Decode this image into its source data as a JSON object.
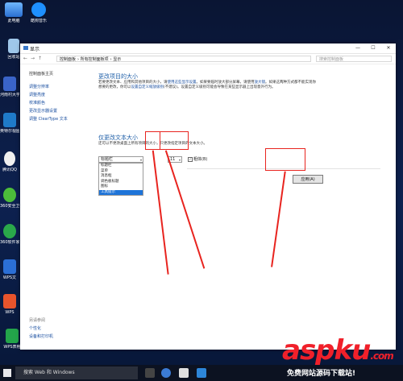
{
  "desktop": {
    "icons": [
      {
        "label": "此电脑"
      },
      {
        "label": "酷狗音乐"
      },
      {
        "label": "回收站"
      },
      {
        "label": "河南村大学认"
      },
      {
        "label": "英特尔视图形"
      },
      {
        "label": "腾讯QQ"
      },
      {
        "label": "360安全卫士"
      },
      {
        "label": "360软件家"
      },
      {
        "label": "WPS文"
      },
      {
        "label": "WPS"
      },
      {
        "label": "WPS表格"
      }
    ]
  },
  "window": {
    "title": "显示",
    "address": {
      "path": [
        "控制面板",
        "所有控制面板项",
        "显示"
      ],
      "search_placeholder": "搜索控制面板"
    },
    "sidebar": {
      "home": "控制面板主页",
      "items": [
        "调整分辨率",
        "调整亮度",
        "校准颜色",
        "更改显示器设置",
        "调整 ClearType 文本"
      ],
      "see_also_title": "另请参阅",
      "see_also": [
        "个性化",
        "设备和打印机"
      ]
    },
    "main": {
      "heading1": "更改项目的大小",
      "para1_a": "若要更改文本、应用和其他项目的大小，请",
      "para1_link1": "使用这些显示设置",
      "para1_b": "。如果要临时放大部分屏幕，请使用",
      "para1_link2": "放大镜",
      "para1_c": "。如果这两种方式都不能实现你想要的更改，你可以",
      "para1_link3": "设置自定义缩放级别",
      "para1_d": "(不建议)。设置自定义级别可能会导致在某些显示器上出现意外行为。",
      "heading2": "仅更改文本大小",
      "para2": "还可以不更改桌面上所有项目的大小，只更改指定项目的文本大小。",
      "item_select": "标题栏",
      "size_select": "11",
      "bold_label": "粗体(B)",
      "dropdown_options": [
        "标题栏",
        "菜单",
        "消息框",
        "调色板标题",
        "图标",
        "工具提示"
      ],
      "selected_option": "工具提示",
      "apply_button": "应用(A)"
    }
  },
  "taskbar": {
    "search_placeholder": "搜索 Web 和 Windows"
  },
  "watermark": {
    "brand": "aspku",
    "suffix": ".com",
    "tagline": "免费网站源码下载站!"
  }
}
